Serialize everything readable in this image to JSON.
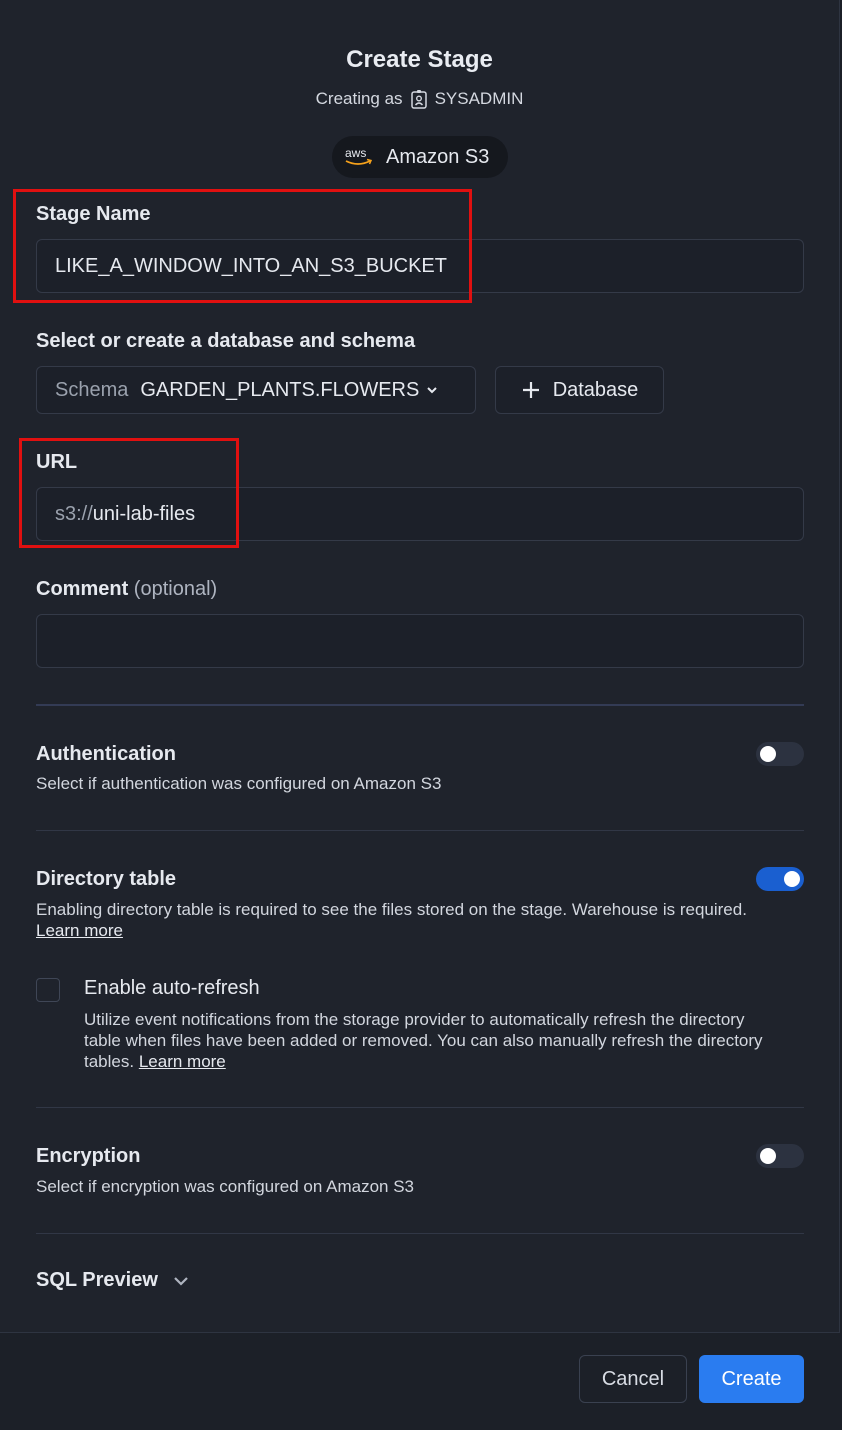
{
  "dialog": {
    "title": "Create Stage",
    "creating_as_prefix": "Creating as",
    "role": "SYSADMIN",
    "role_icon": "user-badge-icon",
    "provider": {
      "logo_text": "aws",
      "label": "Amazon S3"
    }
  },
  "stage_name": {
    "label": "Stage Name",
    "value": "LIKE_A_WINDOW_INTO_AN_S3_BUCKET"
  },
  "schema": {
    "label": "Select or create a database and schema",
    "select_prefix": "Schema",
    "select_value": "GARDEN_PLANTS.FLOWERS",
    "database_button": "Database"
  },
  "url": {
    "label": "URL",
    "prefix": "s3://",
    "value": "uni-lab-files"
  },
  "comment": {
    "label": "Comment",
    "optional": "(optional)",
    "value": ""
  },
  "authentication": {
    "title": "Authentication",
    "description": "Select if authentication was configured on Amazon S3",
    "enabled": false
  },
  "directory_table": {
    "title": "Directory table",
    "description": "Enabling directory table is required to see the files stored on the stage. Warehouse is required.",
    "link": "Learn more",
    "enabled": true,
    "auto_refresh": {
      "label": "Enable auto-refresh",
      "description": "Utilize event notifications from the storage provider to automatically refresh the directory table when files have been added or removed. You can also manually refresh the directory tables.",
      "link": "Learn more",
      "checked": false
    }
  },
  "encryption": {
    "title": "Encryption",
    "description": "Select if encryption was configured on Amazon S3",
    "enabled": false
  },
  "sql_preview": {
    "label": "SQL Preview"
  },
  "footer": {
    "cancel": "Cancel",
    "create": "Create"
  },
  "colors": {
    "accent": "#2a7cf0",
    "toggle_on": "#1a5fd0",
    "highlight": "#e01010",
    "background": "#1f232c"
  }
}
